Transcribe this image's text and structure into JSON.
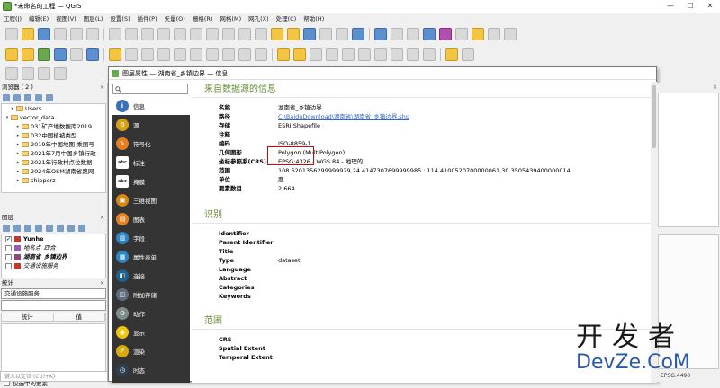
{
  "app": {
    "title": "*未命名的工程 — QGIS"
  },
  "menu": [
    "工程(J)",
    "编辑(E)",
    "视图(V)",
    "图层(L)",
    "设置(S)",
    "插件(P)",
    "矢量(O)",
    "栅格(R)",
    "网格(M)",
    "网孔(X)",
    "处理(C)",
    "帮助(H)"
  ],
  "browser": {
    "title": "浏览器 ( 2 )",
    "items": [
      {
        "label": "Users",
        "indent": 1,
        "arrow": "▸"
      },
      {
        "label": "vector_data",
        "indent": 0,
        "arrow": "▾"
      },
      {
        "label": "031矿产地数据库2019",
        "indent": 2,
        "arrow": "▸"
      },
      {
        "label": "032中国植被类型",
        "indent": 2,
        "arrow": "▸"
      },
      {
        "label": "2019年中国地图-乘图号",
        "indent": 2,
        "arrow": "▸"
      },
      {
        "label": "2021年7月中国乡镇行政",
        "indent": 2,
        "arrow": "▸"
      },
      {
        "label": "2021年行政村点位数据",
        "indent": 2,
        "arrow": "▸"
      },
      {
        "label": "2024年OSM湖南省路网",
        "indent": 2,
        "arrow": "▸"
      },
      {
        "label": "shipperz",
        "indent": 2,
        "arrow": "▸"
      }
    ]
  },
  "layers": {
    "title": "图层",
    "items": [
      {
        "label": "Yunhe",
        "checked": true,
        "bold": true,
        "color": "#c0392b"
      },
      {
        "label": "地名点_四合",
        "checked": false,
        "italic": true,
        "color": "#9b59b6"
      },
      {
        "label": "湖南省_乡镇边界",
        "checked": false,
        "italic": true,
        "bold": true,
        "color": "#8e4a73"
      },
      {
        "label": "交通设施服务",
        "checked": false,
        "italic": true,
        "color": "#c0392b"
      }
    ]
  },
  "stats": {
    "title": "统计",
    "selector": "交通设施服务",
    "col1": "统计",
    "col2": "值",
    "only_selected": "仅选中的要素"
  },
  "locator": {
    "placeholder": "键入以定位 (Ctrl+K)"
  },
  "dialog": {
    "title": "图层属性 — 湖南省_乡镇边界 — 信息",
    "nav": [
      {
        "label": "信息",
        "color": "#3a6fb5",
        "glyph": "i",
        "selected": true
      },
      {
        "label": "源",
        "color": "#d4a017",
        "glyph": "⚙",
        "selected": false
      },
      {
        "label": "符号化",
        "color": "#e67e22",
        "glyph": "✎",
        "selected": false
      },
      {
        "label": "标注",
        "color": "#555555",
        "glyph": "abc",
        "selected": false
      },
      {
        "label": "掩膜",
        "color": "#555555",
        "glyph": "abc",
        "selected": false
      },
      {
        "label": "三维视图",
        "color": "#d68910",
        "glyph": "▣",
        "selected": false
      },
      {
        "label": "图表",
        "color": "#e67e22",
        "glyph": "▤",
        "selected": false
      },
      {
        "label": "字段",
        "color": "#2e86c1",
        "glyph": "▥",
        "selected": false
      },
      {
        "label": "属性表单",
        "color": "#2e86c1",
        "glyph": "▦",
        "selected": false
      },
      {
        "label": "连接",
        "color": "#1f618d",
        "glyph": "◧",
        "selected": false
      },
      {
        "label": "附加存储",
        "color": "#5d6d7e",
        "glyph": "◫",
        "selected": false
      },
      {
        "label": "动作",
        "color": "#7f8c8d",
        "glyph": "⚙",
        "selected": false
      },
      {
        "label": "显示",
        "color": "#f1c40f",
        "glyph": "◉",
        "selected": false
      },
      {
        "label": "渲染",
        "color": "#d4ac0d",
        "glyph": "✐",
        "selected": false
      },
      {
        "label": "时态",
        "color": "#2e4053",
        "glyph": "◷",
        "selected": false
      }
    ],
    "source_section": {
      "title": "来自数据源的信息",
      "rows": [
        {
          "key": "名称",
          "value": "湖南省_乡镇边界",
          "link": false
        },
        {
          "key": "路径",
          "value": "C:\\BaiduDownload\\湖南省\\湖南省_乡镇边界.shp",
          "link": true
        },
        {
          "key": "存储",
          "value": "ESRI Shapefile",
          "link": false
        },
        {
          "key": "注释",
          "value": "",
          "link": false
        },
        {
          "key": "编码",
          "value": "ISO-8859-1",
          "link": false
        },
        {
          "key": "几何图形",
          "value": "Polygon (MultiPolygon)",
          "link": false
        },
        {
          "key": "坐标参照系(CRS)",
          "value": "EPSG:4326 - WGS 84 - 地理的",
          "link": false
        },
        {
          "key": "范围",
          "value": "108.6201356299999929,24.4147307699999985 : 114.4100520700000061,30.3505439400000014",
          "link": false
        },
        {
          "key": "单位",
          "value": "度",
          "link": false
        },
        {
          "key": "要素数目",
          "value": "2,664",
          "link": false
        }
      ]
    },
    "identification": {
      "title": "识别",
      "rows": [
        {
          "key": "Identifier",
          "value": ""
        },
        {
          "key": "Parent Identifier",
          "value": ""
        },
        {
          "key": "Title",
          "value": ""
        },
        {
          "key": "Type",
          "value": "dataset"
        },
        {
          "key": "Language",
          "value": ""
        },
        {
          "key": "Abstract",
          "value": ""
        },
        {
          "key": "Categories",
          "value": ""
        },
        {
          "key": "Keywords",
          "value": ""
        }
      ]
    },
    "extent": {
      "title": "范围",
      "rows": [
        {
          "key": "CRS",
          "value": ""
        },
        {
          "key": "Spatial Extent",
          "value": ""
        },
        {
          "key": "Temporal Extent",
          "value": ""
        }
      ]
    }
  },
  "watermark": {
    "cn": "开发者",
    "en": "DevZe.CoM"
  },
  "status": {
    "epsg": "EPSG:4490"
  }
}
